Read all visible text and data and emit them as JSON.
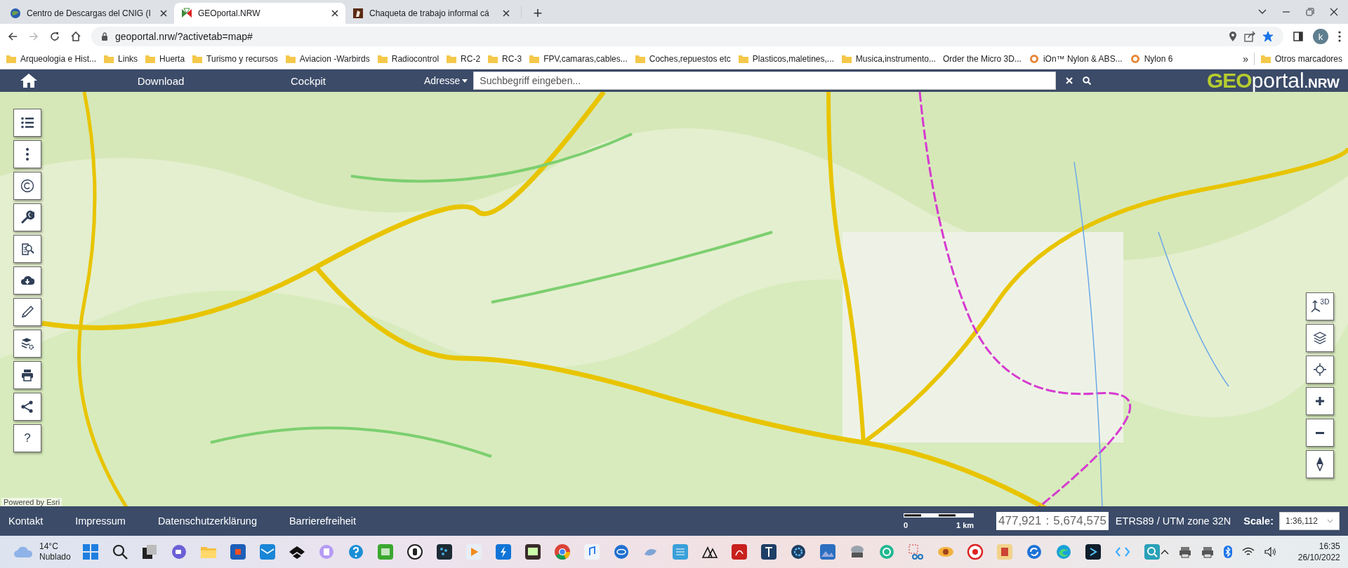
{
  "browser": {
    "tabs": [
      {
        "title": "Centro de Descargas del CNIG (I",
        "selected": false
      },
      {
        "title": "GEOportal.NRW",
        "selected": true
      },
      {
        "title": "Chaqueta de trabajo informal cá",
        "selected": false
      }
    ],
    "new_tab": "+",
    "address": "geoportal.nrw/?activetab=map#",
    "forward_disabled": true,
    "bookmarked": true,
    "profile": "k",
    "bookmarks": [
      {
        "label": "Arqueologia e Hist...",
        "kind": "folder"
      },
      {
        "label": "Links",
        "kind": "folder"
      },
      {
        "label": "Huerta",
        "kind": "folder"
      },
      {
        "label": "Turismo y recursos",
        "kind": "folder"
      },
      {
        "label": "Aviacion -Warbirds",
        "kind": "folder"
      },
      {
        "label": "Radiocontrol",
        "kind": "folder"
      },
      {
        "label": "RC-2",
        "kind": "folder"
      },
      {
        "label": "RC-3",
        "kind": "folder"
      },
      {
        "label": "FPV,camaras,cables...",
        "kind": "folder"
      },
      {
        "label": "Coches,repuestos etc",
        "kind": "folder"
      },
      {
        "label": "Plasticos,maletines,...",
        "kind": "folder"
      },
      {
        "label": "Musica,instrumento...",
        "kind": "folder"
      },
      {
        "label": "Order the Micro 3D...",
        "kind": "link"
      },
      {
        "label": "iOn™ Nylon & ABS...",
        "kind": "site"
      },
      {
        "label": "Nylon 6",
        "kind": "site"
      }
    ],
    "more_bookmarks": "»",
    "other_bookmarks": "Otros marcadores"
  },
  "header": {
    "nav": [
      "Download",
      "Cockpit"
    ],
    "search_scope": "Adresse",
    "search": {
      "placeholder": "Suchbegriff eingeben..."
    },
    "logo": {
      "prefix": "GEO",
      "name": "portal",
      "suffix": ".NRW"
    }
  },
  "map": {
    "help_label": "?",
    "view_3d_label": "3D",
    "attribution": "Powered by Esri"
  },
  "footer": {
    "links": [
      "Kontakt",
      "Impressum",
      "Datenschutzerklärung",
      "Barrierefreiheit"
    ],
    "scale_bar": {
      "start": "0",
      "end": "1 km"
    },
    "coordinates": {
      "easting": "477,921",
      "separator": ":",
      "northing": "5,674,575"
    },
    "crs": "ETRS89 / UTM zone 32N",
    "scale_label": "Scale:",
    "scale_value": "1:36,112"
  },
  "taskbar": {
    "weather": {
      "temperature": "14°C",
      "condition": "Nublado"
    },
    "time": "16:35",
    "date": "26/10/2022"
  }
}
